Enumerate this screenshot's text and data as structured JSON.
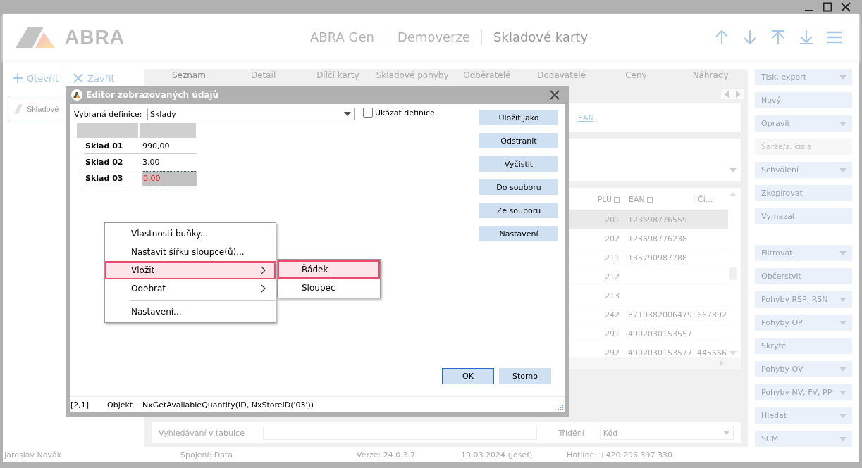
{
  "header": {
    "logo": "ABRA",
    "titles": [
      "ABRA Gen",
      "Demoverze",
      "Skladové karty"
    ]
  },
  "left_panel": {
    "actions": [
      {
        "label": "Otevřít",
        "kind": "open"
      },
      {
        "label": "Zavřít",
        "kind": "close"
      }
    ],
    "open_tab": {
      "label": "Skladové"
    }
  },
  "tabs": [
    {
      "label": "Seznam",
      "selected": true
    },
    {
      "label": "Detail",
      "selected": false
    },
    {
      "label": "Dílčí karty",
      "selected": false
    },
    {
      "label": "Skladové pohyby",
      "selected": false
    },
    {
      "label": "Odběratelé",
      "selected": false
    },
    {
      "label": "Dodavatelé",
      "selected": false
    },
    {
      "label": "Ceny",
      "selected": false
    },
    {
      "label": "Náhrady",
      "selected": false
    }
  ],
  "column_links": [
    "EAN"
  ],
  "table": {
    "columns": [
      "PLU",
      "EAN",
      "Čí..."
    ],
    "rows": [
      {
        "selected": true,
        "cells": [
          "201",
          "123698776559",
          ""
        ]
      },
      {
        "selected": false,
        "cells": [
          "202",
          "123698776238",
          ""
        ]
      },
      {
        "selected": false,
        "cells": [
          "211",
          "135790987788",
          ""
        ]
      },
      {
        "selected": false,
        "cells": [
          "212",
          "",
          ""
        ]
      },
      {
        "selected": false,
        "cells": [
          "213",
          "",
          ""
        ]
      },
      {
        "selected": false,
        "cells": [
          "242",
          "8710382006479",
          "667892"
        ]
      },
      {
        "selected": false,
        "cells": [
          "291",
          "4902030153557",
          ""
        ]
      },
      {
        "selected": false,
        "cells": [
          "292",
          "4902030153577",
          "445666"
        ]
      }
    ]
  },
  "search_bar": {
    "label": "Vyhledávání v tabulce",
    "sort_label": "Třídění",
    "sort_value": "Kód"
  },
  "sidebar": {
    "groups": [
      [
        {
          "label": "Tisk, export",
          "kind": "dropdown",
          "disabled": false
        },
        {
          "label": "Nový",
          "kind": "button",
          "disabled": false
        },
        {
          "label": "Opravit",
          "kind": "dropdown",
          "disabled": false
        },
        {
          "label": "Šarže/s. čísla",
          "kind": "button",
          "disabled": true
        },
        {
          "label": "Schválení",
          "kind": "dropdown",
          "disabled": false
        },
        {
          "label": "Zkopírovat",
          "kind": "button",
          "disabled": false
        },
        {
          "label": "Vymazat",
          "kind": "button",
          "disabled": false
        }
      ],
      [
        {
          "label": "Filtrovat",
          "kind": "dropdown",
          "disabled": false
        },
        {
          "label": "Občerstvit",
          "kind": "button",
          "disabled": false
        },
        {
          "label": "Pohyby RSP, RSN",
          "kind": "dropdown",
          "disabled": false
        },
        {
          "label": "Pohyby OP",
          "kind": "dropdown",
          "disabled": false
        },
        {
          "label": "Skryté",
          "kind": "button",
          "disabled": false
        },
        {
          "label": "Pohyby OV",
          "kind": "dropdown",
          "disabled": false
        },
        {
          "label": "Pohyby NV, FV, PP",
          "kind": "dropdown",
          "disabled": false
        },
        {
          "label": "Hledat",
          "kind": "dropdown",
          "disabled": false
        },
        {
          "label": "SCM",
          "kind": "dropdown",
          "disabled": false
        }
      ]
    ]
  },
  "status_bar": [
    "Jaroslav Novák",
    "Spojení: Data",
    "Verze: 24.0.3.7",
    "19.03.2024 (Josef)",
    "Hotline: +420 296 397 330"
  ],
  "dialog": {
    "title": "Editor zobrazovaných údajů",
    "definition_label": "Vybraná definice:",
    "definition_value": "Sklady",
    "show_definition": {
      "label": "Ukázat definice",
      "checked": false
    },
    "grid": [
      {
        "label": "Sklad 01",
        "value": "990,00",
        "selected": false,
        "negative": false
      },
      {
        "label": "Sklad 02",
        "value": "3,00",
        "selected": false,
        "negative": false
      },
      {
        "label": "Sklad 03",
        "value": "0,00",
        "selected": true,
        "negative": true
      }
    ],
    "buttons": [
      "Uložit jako",
      "Odstranit",
      "Vyčistit",
      "Do souboru",
      "Ze souboru",
      "Nastavení"
    ],
    "footer_buttons": [
      {
        "label": "OK",
        "default": true
      },
      {
        "label": "Storno",
        "default": false
      }
    ],
    "status": [
      "[2,1]",
      "Objekt",
      "NxGetAvailableQuantity(ID, NxStoreID('03'))"
    ]
  },
  "context_menu": {
    "items": [
      {
        "label": "Vlastnosti buňky...",
        "submenu": false,
        "selected": false,
        "separator_before": false
      },
      {
        "label": "Nastavit šířku sloupce(ů)...",
        "submenu": false,
        "selected": false,
        "separator_before": false
      },
      {
        "label": "Vložit",
        "submenu": true,
        "selected": true,
        "separator_before": false
      },
      {
        "label": "Odebrat",
        "submenu": true,
        "selected": false,
        "separator_before": false
      },
      {
        "label": "Nastavení...",
        "submenu": false,
        "selected": false,
        "separator_before": true
      }
    ],
    "submenu": [
      {
        "label": "Řádek",
        "selected": true
      },
      {
        "label": "Sloupec",
        "selected": false
      }
    ]
  }
}
